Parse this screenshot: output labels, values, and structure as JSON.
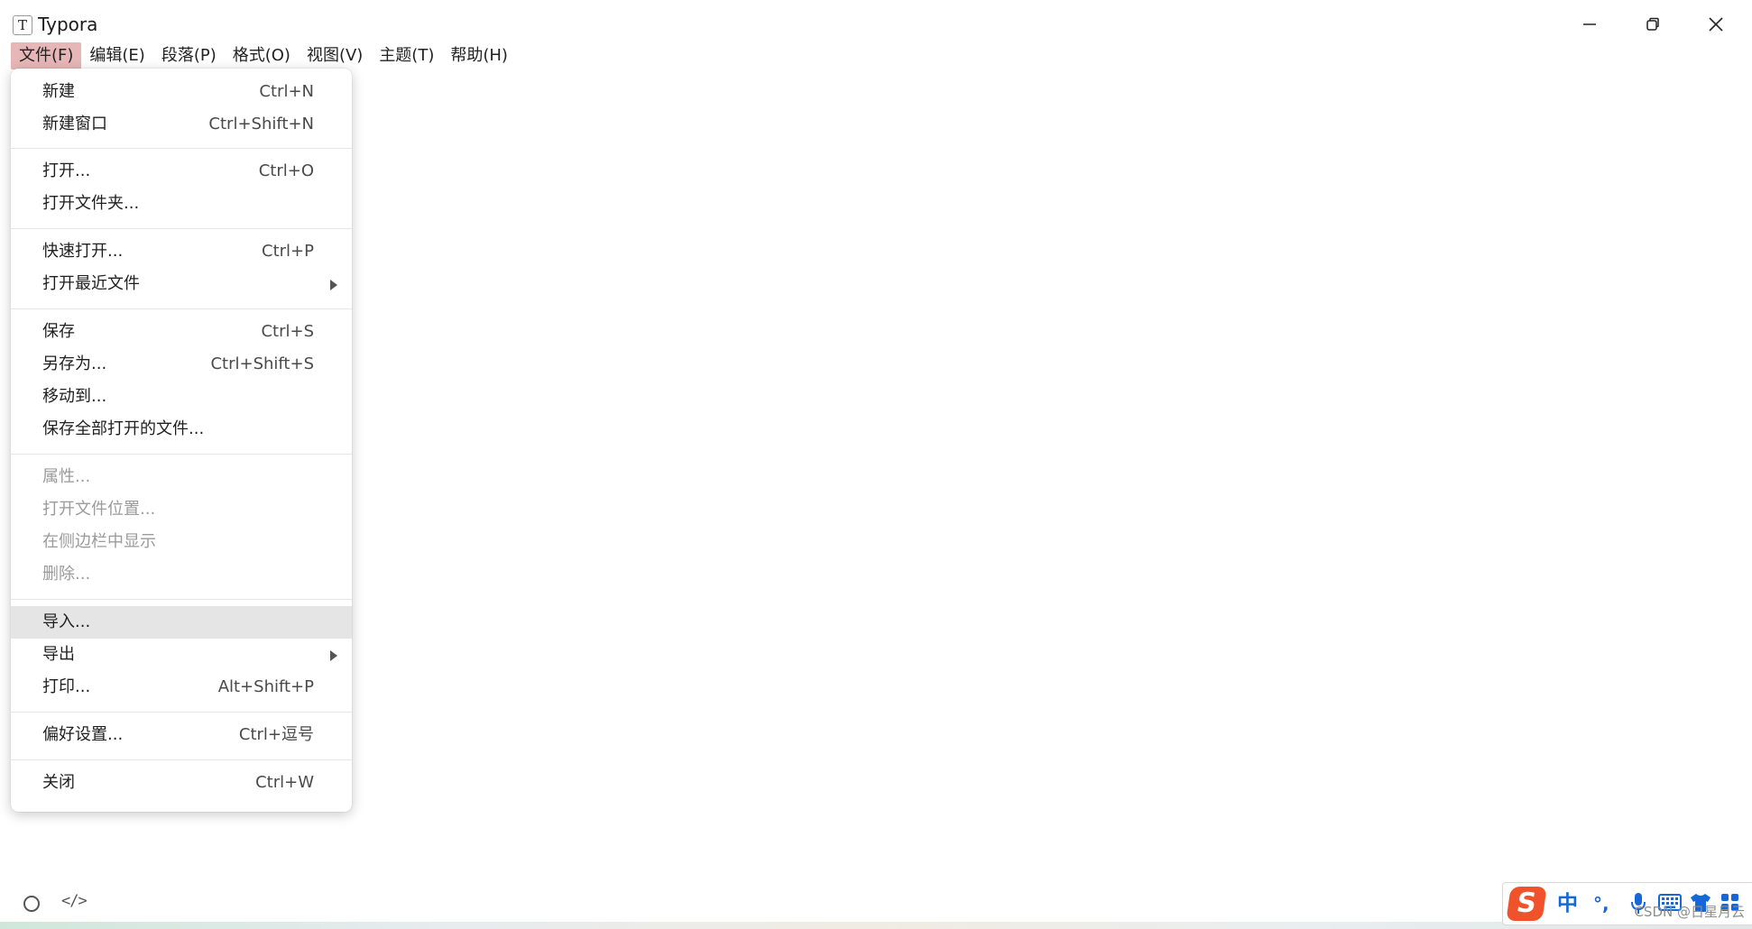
{
  "window": {
    "app_icon_glyph": "T",
    "title": "Typora"
  },
  "menubar": [
    "文件(F)",
    "编辑(E)",
    "段落(P)",
    "格式(O)",
    "视图(V)",
    "主题(T)",
    "帮助(H)"
  ],
  "file_menu": {
    "items": {
      "new": {
        "label": "新建",
        "shortcut": "Ctrl+N"
      },
      "new_window": {
        "label": "新建窗口",
        "shortcut": "Ctrl+Shift+N"
      },
      "open": {
        "label": "打开...",
        "shortcut": "Ctrl+O"
      },
      "open_folder": {
        "label": "打开文件夹..."
      },
      "quick_open": {
        "label": "快速打开...",
        "shortcut": "Ctrl+P"
      },
      "open_recent": {
        "label": "打开最近文件"
      },
      "save": {
        "label": "保存",
        "shortcut": "Ctrl+S"
      },
      "save_as": {
        "label": "另存为...",
        "shortcut": "Ctrl+Shift+S"
      },
      "move_to": {
        "label": "移动到..."
      },
      "save_all": {
        "label": "保存全部打开的文件..."
      },
      "properties": {
        "label": "属性..."
      },
      "open_location": {
        "label": "打开文件位置..."
      },
      "reveal_sidebar": {
        "label": "在侧边栏中显示"
      },
      "delete": {
        "label": "删除..."
      },
      "import": {
        "label": "导入..."
      },
      "export": {
        "label": "导出"
      },
      "print": {
        "label": "打印...",
        "shortcut": "Alt+Shift+P"
      },
      "preferences": {
        "label": "偏好设置...",
        "shortcut": "Ctrl+逗号"
      },
      "close": {
        "label": "关闭",
        "shortcut": "Ctrl+W"
      }
    },
    "highlighted_item": "导入...",
    "disabled_items": [
      "属性...",
      "打开文件位置...",
      "在侧边栏中显示",
      "删除..."
    ]
  },
  "statusbar": {
    "code_icon_text": "</>"
  },
  "ime_toolbar": {
    "logo": "S",
    "mode_text": "中",
    "punct_text": "°,"
  },
  "watermark": "CSDN @日星月云",
  "colors": {
    "menu_active_bg": "#e7b7b7",
    "menu_highlight_bg": "#e5e5e5",
    "disabled_text": "#9b9b9b",
    "ime_logo": "#f0522b",
    "ime_blue": "#1668d8"
  }
}
